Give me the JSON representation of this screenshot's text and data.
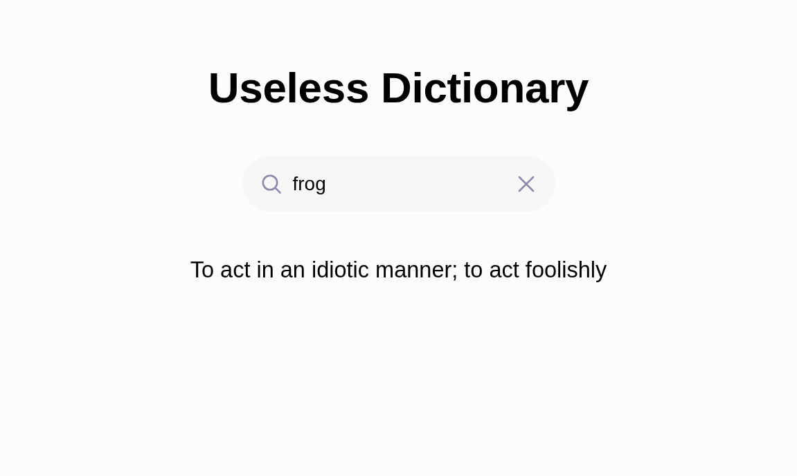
{
  "title": "Useless Dictionary",
  "search": {
    "value": "frog"
  },
  "definition": "To act in an idiotic manner; to act foolishly"
}
